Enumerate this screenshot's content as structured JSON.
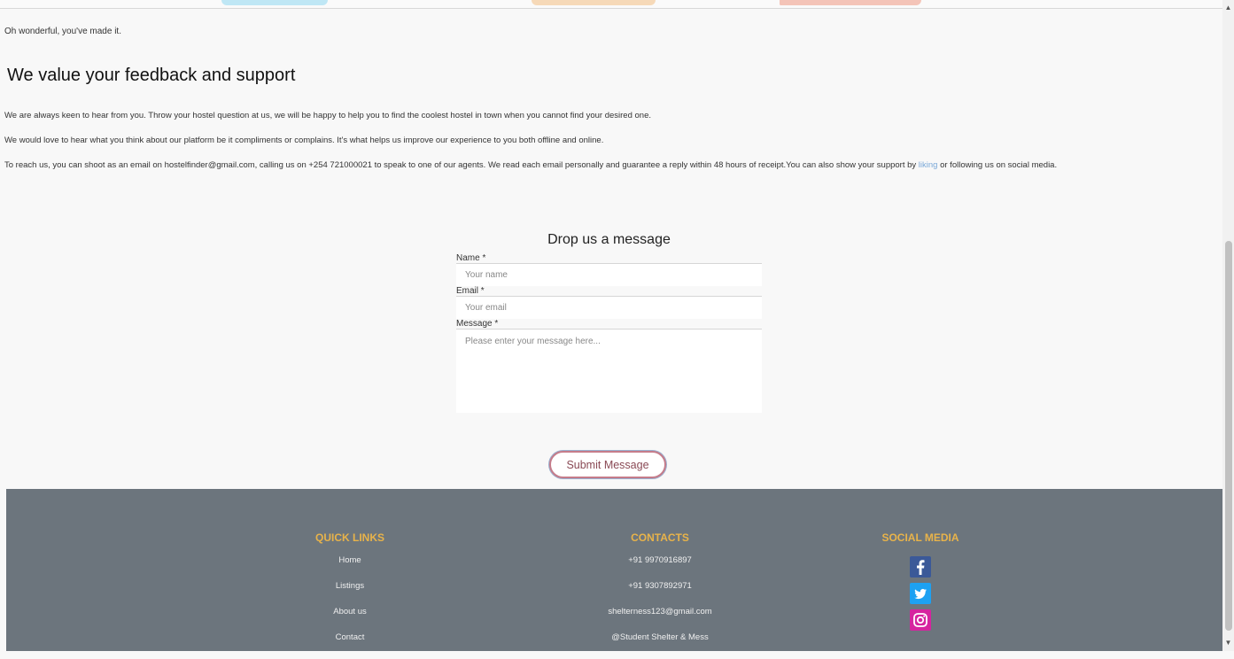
{
  "intro": "Oh wonderful, you've made it.",
  "heading": "We value your feedback and support",
  "paragraphs": {
    "p1": "We are always keen to hear from you. Throw your hostel question at us, we will be happy to help you to find the coolest hostel in town when you cannot find your desired one.",
    "p2": "We would love to hear what you think about our platform be it compliments or complains. It's what helps us improve our experience to you both offline and online.",
    "p3_start": "To reach us, you can shoot as an email on hostelfinder@gmail.com, calling us on +254 721000021 to speak to one of our agents. We read each email personally and guarantee a reply within 48 hours of receipt.You can also show your support by ",
    "p3_link": "liking",
    "p3_end": " or following us on social media."
  },
  "form": {
    "title": "Drop us a message",
    "name_label": "Name *",
    "name_placeholder": "Your name",
    "email_label": "Email *",
    "email_placeholder": "Your email",
    "message_label": "Message *",
    "message_placeholder": "Please enter your message here...",
    "submit_label": "Submit Message"
  },
  "footer": {
    "quick_links": {
      "title": "QUICK LINKS",
      "items": [
        "Home",
        "Listings",
        "About us",
        "Contact"
      ]
    },
    "contacts": {
      "title": "CONTACTS",
      "items": [
        "+91 9970916897",
        "+91 9307892971",
        "shelterness123@gmail.com",
        "@Student Shelter & Mess"
      ]
    },
    "social_media": {
      "title": "SOCIAL MEDIA",
      "icons": [
        "facebook-icon",
        "twitter-icon",
        "instagram-icon"
      ]
    }
  },
  "colors": {
    "footer_bg": "#6c757d",
    "footer_heading": "#e8b34a",
    "submit_border": "#c57c8a"
  }
}
